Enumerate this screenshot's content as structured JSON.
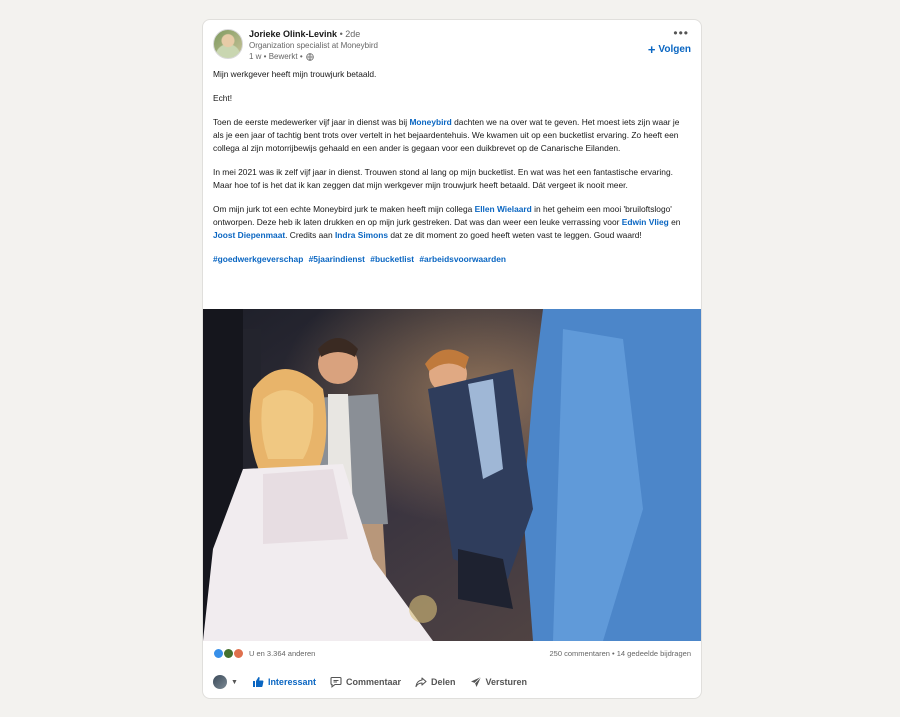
{
  "post": {
    "author": {
      "name": "Jorieke Olink-Levink",
      "degree": "• 2de",
      "headline": "Organization specialist at Moneybird",
      "time": "1 w • Bewerkt •",
      "visibility_icon": "globe-icon"
    },
    "more_label": "•••",
    "follow_label": "Volgen",
    "paragraphs": {
      "p1": "Mijn werkgever heeft mijn trouwjurk betaald.",
      "p2": "Echt!",
      "p3a": "Toen de eerste medewerker vijf jaar in dienst was bij ",
      "p3_mention": "Moneybird",
      "p3b": " dachten we na over wat te geven. Het moest iets zijn waar je als je een jaar of tachtig bent trots over vertelt in het bejaardentehuis. We kwamen uit op een bucketlist ervaring. Zo heeft een collega al zijn motorrijbewijs gehaald en een ander is gegaan voor een duikbrevet op de Canarische Eilanden.",
      "p4": "In mei 2021 was ik zelf vijf jaar in dienst. Trouwen stond al lang op mijn bucketlist. En wat was het een fantastische ervaring. Maar hoe tof is het dat ik kan zeggen dat mijn werkgever mijn trouwjurk heeft betaald. Dát vergeet ik nooit meer.",
      "p5a": "Om mijn jurk tot een echte Moneybird jurk te maken heeft mijn collega ",
      "p5_m1": "Ellen Wielaard",
      "p5b": " in het geheim een mooi 'bruiloftslogo' ontworpen. Deze heb ik laten drukken en op mijn jurk gestreken. Dat was dan weer een leuke verrassing voor ",
      "p5_m2": "Edwin Vlieg",
      "p5c": " en ",
      "p5_m3": "Joost Diepenmaat",
      "p5d": ". Credits aan ",
      "p5_m4": "Indra Simons",
      "p5e": " dat ze dit moment zo goed heeft weten vast te leggen. Goud waard!"
    },
    "hashtags": [
      "#goedwerkgeverschap",
      "#5jaarindienst",
      "#bucketlist",
      "#arbeidsvoorwaarden"
    ],
    "social": {
      "reactions_text": "U en 3.364 anderen",
      "comments_text": "250 commentaren • 14 gedeelde bijdragen"
    },
    "actions": {
      "interessant": "Interessant",
      "commentaar": "Commentaar",
      "delen": "Delen",
      "versturen": "Versturen"
    }
  },
  "colors": {
    "accent": "#0a66c2",
    "page_bg": "#f3f2ef"
  }
}
